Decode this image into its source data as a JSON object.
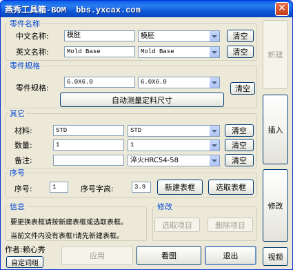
{
  "window": {
    "title": "燕秀工具箱-BOM  bbs.yxcax.com",
    "close_symbol": "✕"
  },
  "part_name": {
    "legend": "零件名称",
    "cn_label": "中文名称:",
    "cn_value": "模胚",
    "cn_combo": "模胚",
    "en_label": "英文名称:",
    "en_value": "Mold Base",
    "en_combo": "Mold Base",
    "clear": "清空"
  },
  "part_spec": {
    "legend": "零件规格",
    "label": "零件规格:",
    "value": "6.0X6.0",
    "combo": "6.0X6.0",
    "clear": "清空",
    "auto_measure": "自动测量定料尺寸"
  },
  "other": {
    "legend": "其它",
    "material_label": "材料:",
    "material_value": "STD",
    "material_combo": "STD",
    "qty_label": "数量:",
    "qty_value": "1",
    "qty_combo": "1",
    "note_label": "备注:",
    "note_value": "",
    "note_combo": "淬火HRC54-58",
    "clear": "清空"
  },
  "serial": {
    "legend": "序号",
    "label": "序号:",
    "value": "1",
    "font_label": "序号字高:",
    "font_value": "3.9",
    "new_table": "新建表框",
    "select_table": "选取表框"
  },
  "info": {
    "legend": "信息",
    "line1": "要更换表框请按新建表框或选取表框。",
    "line2": "当前文件内没有表框!请先新建表框。"
  },
  "modify": {
    "legend": "修改",
    "select_item": "选取项目",
    "delete_item": "删除项目"
  },
  "side_buttons": {
    "new": "新建",
    "insert": "插入",
    "modify": "修改"
  },
  "footer": {
    "author": "作者:赖心秀",
    "custom_words": "自定词组",
    "apply": "应用",
    "view": "看图",
    "exit": "退出",
    "video": "视频"
  }
}
